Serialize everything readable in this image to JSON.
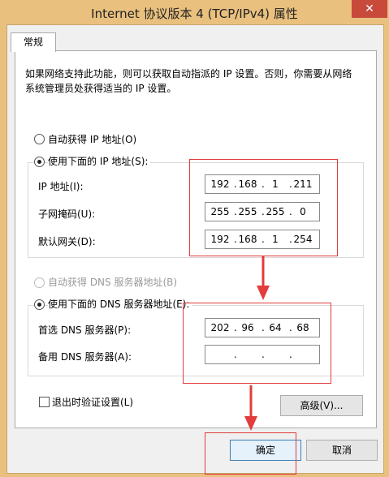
{
  "window": {
    "title": "Internet 协议版本 4 (TCP/IPv4) 属性",
    "close_glyph": "✕"
  },
  "tabs": [
    {
      "label": "常规"
    }
  ],
  "description": "如果网络支持此功能，则可以获取自动指派的 IP 设置。否则，你需要从网络系统管理员处获得适当的 IP 设置。",
  "ip_section": {
    "auto_label": "自动获得 IP 地址(O)",
    "manual_label": "使用下面的 IP 地址(S):",
    "selected": "manual",
    "fields": [
      {
        "label": "IP 地址(I):",
        "octets": [
          "192",
          "168",
          "1",
          "211"
        ]
      },
      {
        "label": "子网掩码(U):",
        "octets": [
          "255",
          "255",
          "255",
          "0"
        ]
      },
      {
        "label": "默认网关(D):",
        "octets": [
          "192",
          "168",
          "1",
          "254"
        ]
      }
    ]
  },
  "dns_section": {
    "auto_label": "自动获得 DNS 服务器地址(B)",
    "auto_disabled": true,
    "manual_label": "使用下面的 DNS 服务器地址(E):",
    "selected": "manual",
    "fields": [
      {
        "label": "首选 DNS 服务器(P):",
        "octets": [
          "202",
          "96",
          "64",
          "68"
        ]
      },
      {
        "label": "备用 DNS 服务器(A):",
        "octets": [
          "",
          "",
          "",
          ""
        ]
      }
    ]
  },
  "validate_on_exit": {
    "label": "退出时验证设置(L)",
    "checked": false
  },
  "buttons": {
    "advanced": "高级(V)...",
    "ok": "确定",
    "cancel": "取消"
  },
  "annotation_color": "#e23c3c"
}
